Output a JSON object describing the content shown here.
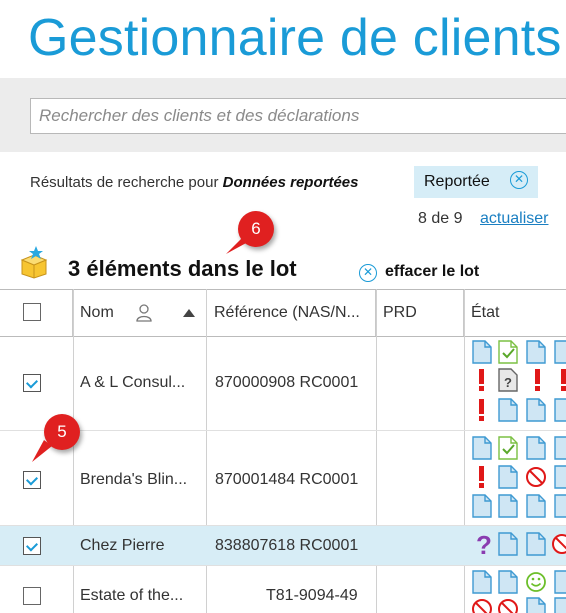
{
  "header": {
    "title": "Gestionnaire de clients"
  },
  "search": {
    "placeholder": "Rechercher des clients et des déclarations"
  },
  "results": {
    "prefix": "Résultats de recherche pour",
    "query": "Données reportées",
    "filter_label": "Reportée",
    "count": "8 de 9",
    "refresh_label": "actualiser"
  },
  "batch": {
    "label": "3 éléments dans le lot",
    "clear_label": "effacer le lot"
  },
  "callouts": {
    "six": "6",
    "five": "5"
  },
  "table": {
    "columns": {
      "name": "Nom",
      "reference": "Référence (NAS/N...",
      "prd": "PRD",
      "status": "État"
    },
    "rows": [
      {
        "checked": true,
        "name": "A & L Consul...",
        "reference": "870000908 RC0001",
        "prd": ""
      },
      {
        "checked": true,
        "name": "Brenda's Blin...",
        "reference": "870001484 RC0001",
        "prd": ""
      },
      {
        "checked": true,
        "name": "Chez Pierre",
        "reference": "838807618 RC0001",
        "prd": ""
      },
      {
        "checked": false,
        "name": "Estate of the...",
        "reference": "T81-9094-49",
        "prd": ""
      }
    ]
  },
  "colors": {
    "accent": "#1a9bd7",
    "callout": "#e02020",
    "selected_row": "#d7edf6"
  }
}
